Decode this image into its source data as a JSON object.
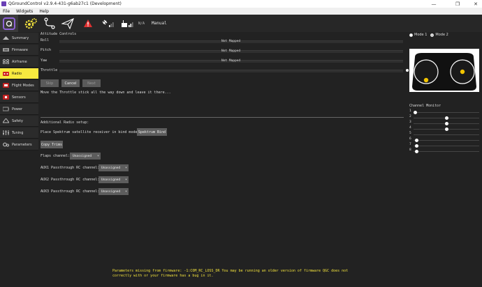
{
  "window": {
    "title": "QGroundControl v2.9.4-431-g6ab27c1 (Development)"
  },
  "menu": {
    "file": "File",
    "widgets": "Widgets",
    "help": "Help"
  },
  "toolbar": {
    "gps_text": "N/A",
    "flight_mode": "Manual"
  },
  "sidebar": {
    "items": [
      {
        "label": "Summary"
      },
      {
        "label": "Firmware"
      },
      {
        "label": "Airframe"
      },
      {
        "label": "Radio"
      },
      {
        "label": "Flight Modes"
      },
      {
        "label": "Sensors"
      },
      {
        "label": "Power"
      },
      {
        "label": "Safety"
      },
      {
        "label": "Tuning"
      },
      {
        "label": "Parameters"
      }
    ],
    "active_index": 3
  },
  "attitude": {
    "section_title": "Attitude Controls",
    "rows": [
      {
        "label": "Roll",
        "value": "Not Mapped"
      },
      {
        "label": "Pitch",
        "value": "Not Mapped"
      },
      {
        "label": "Yaw",
        "value": "Not Mapped"
      },
      {
        "label": "Throttle",
        "value": ""
      }
    ]
  },
  "calibration": {
    "skip": "Skip",
    "cancel": "Cancel",
    "next": "Next",
    "instruction": "Move the Throttle stick all the way down and leave it there..."
  },
  "additional": {
    "title": "Additional Radio setup:",
    "spektrum_label": "Place Spektrum satellite receiver in bind mode:",
    "spektrum_button": "Spektrum Bind",
    "copy_trims": "Copy Trims",
    "flaps_label": "Flaps channel:",
    "flaps_value": "Unassigned",
    "aux": [
      {
        "label": "AUX1 Passthrough RC channel:",
        "value": "Unassigned"
      },
      {
        "label": "AUX2 Passthrough RC channel:",
        "value": "Unassigned"
      },
      {
        "label": "AUX3 Passthrough RC channel:",
        "value": "Unassigned"
      }
    ]
  },
  "mode_select": {
    "mode1": "Mode 1",
    "mode2": "Mode 2",
    "selected": "Mode 2"
  },
  "channel_monitor": {
    "title": "Channel Monitor",
    "channels": [
      {
        "label": "1",
        "pos": 0
      },
      {
        "label": "2",
        "pos": 0.5
      },
      {
        "label": "3",
        "pos": 0.5
      },
      {
        "label": "4",
        "pos": 0.5
      },
      {
        "label": "5",
        "pos": 0
      },
      {
        "label": "6",
        "pos": 0.02
      },
      {
        "label": "7",
        "pos": 0.02
      },
      {
        "label": "8",
        "pos": 0.02
      }
    ]
  },
  "footer": {
    "line1": "Parameters missing from firmware: -1:COM_RC_LOSS_DR  You may be running an older version of firmware QGC does not",
    "line2": "correctly with or your firmware has a bug in it."
  },
  "colors": {
    "accent": "#f7e93f",
    "stick_dot": "#f2c400",
    "warning": "#f2e23c"
  }
}
